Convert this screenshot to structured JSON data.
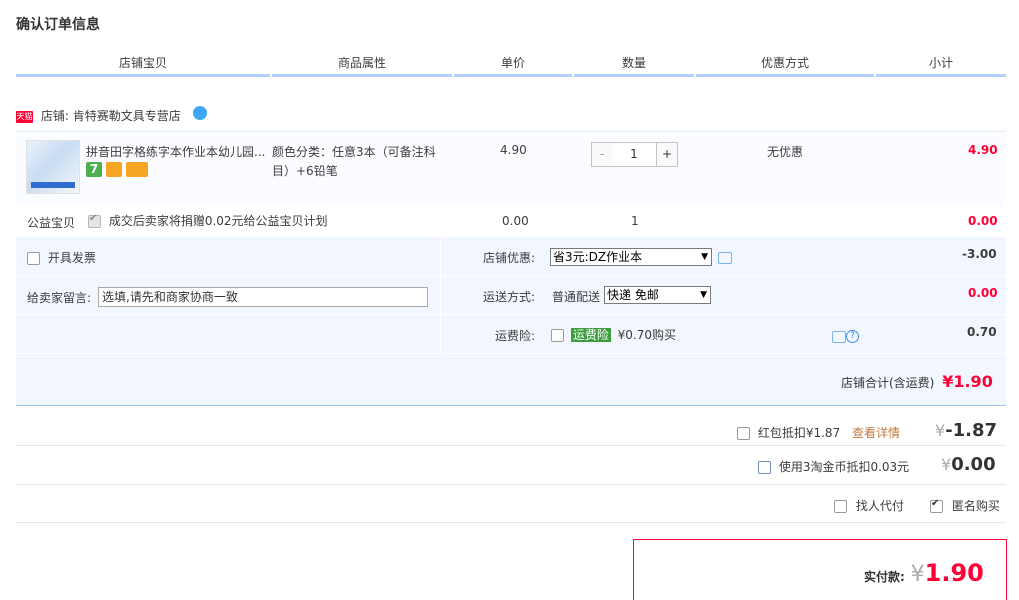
{
  "title": "确认订单信息",
  "columns": [
    "店铺宝贝",
    "商品属性",
    "单价",
    "数量",
    "优惠方式",
    "小计"
  ],
  "shop": {
    "badge": "天猫",
    "label": "店铺:",
    "name": "肯特赛勒文具专营店"
  },
  "item": {
    "name": "拼音田字格练字本作业本幼儿园...",
    "attr_line1": "颜色分类：任意3本（可备注科",
    "attr_line2": "目）+6铅笔",
    "price": "4.90",
    "qty_minus": "-",
    "qty": "1",
    "qty_plus": "+",
    "promo": "无优惠",
    "subtotal": "4.90",
    "badges": [
      {
        "icon": "seven-day-return-icon",
        "text": "7",
        "color": "#4cb04f"
      },
      {
        "icon": "guarantee-icon",
        "text": "",
        "color": "#f6a623"
      },
      {
        "icon": "credit-card-icon",
        "text": "",
        "color": "#f5a623"
      }
    ]
  },
  "charity": {
    "label": "公益宝贝",
    "text": "成交后卖家将捐赠0.02元给公益宝贝计划",
    "price": "0.00",
    "qty": "1",
    "subtotal": "0.00"
  },
  "invoice": {
    "label": "开具发票"
  },
  "shop_discount": {
    "label": "店铺优惠:",
    "selected": "省3元:DZ作业本",
    "amount": "-3.00"
  },
  "message": {
    "label": "给卖家留言:",
    "placeholder": "选填,请先和商家协商一致"
  },
  "shipping": {
    "label": "运送方式:",
    "method": "普通配送",
    "selected": "快递 免邮",
    "amount": "0.00"
  },
  "insurance": {
    "label": "运费险:",
    "tag": "运费险",
    "text": "¥0.70购买",
    "amount": "0.70"
  },
  "shop_total": {
    "label": "店铺合计(含运费)",
    "currency": "¥",
    "value": "1.90"
  },
  "red_packet": {
    "label": "红包抵扣¥1.87",
    "link": "查看详情",
    "currency": "¥",
    "value": "-1.87"
  },
  "coins": {
    "label": "使用3淘金币抵扣0.03元",
    "currency": "¥",
    "value": "0.00"
  },
  "options": {
    "pay_for_me": "找人代付",
    "anonymous": "匿名购买"
  },
  "pay": {
    "label": "实付款:",
    "currency": "¥",
    "value": "1.90"
  },
  "colors": {
    "accent": "#ff0036",
    "header_line": "#b2d1ff",
    "panel_bg": "#f2f7ff"
  }
}
